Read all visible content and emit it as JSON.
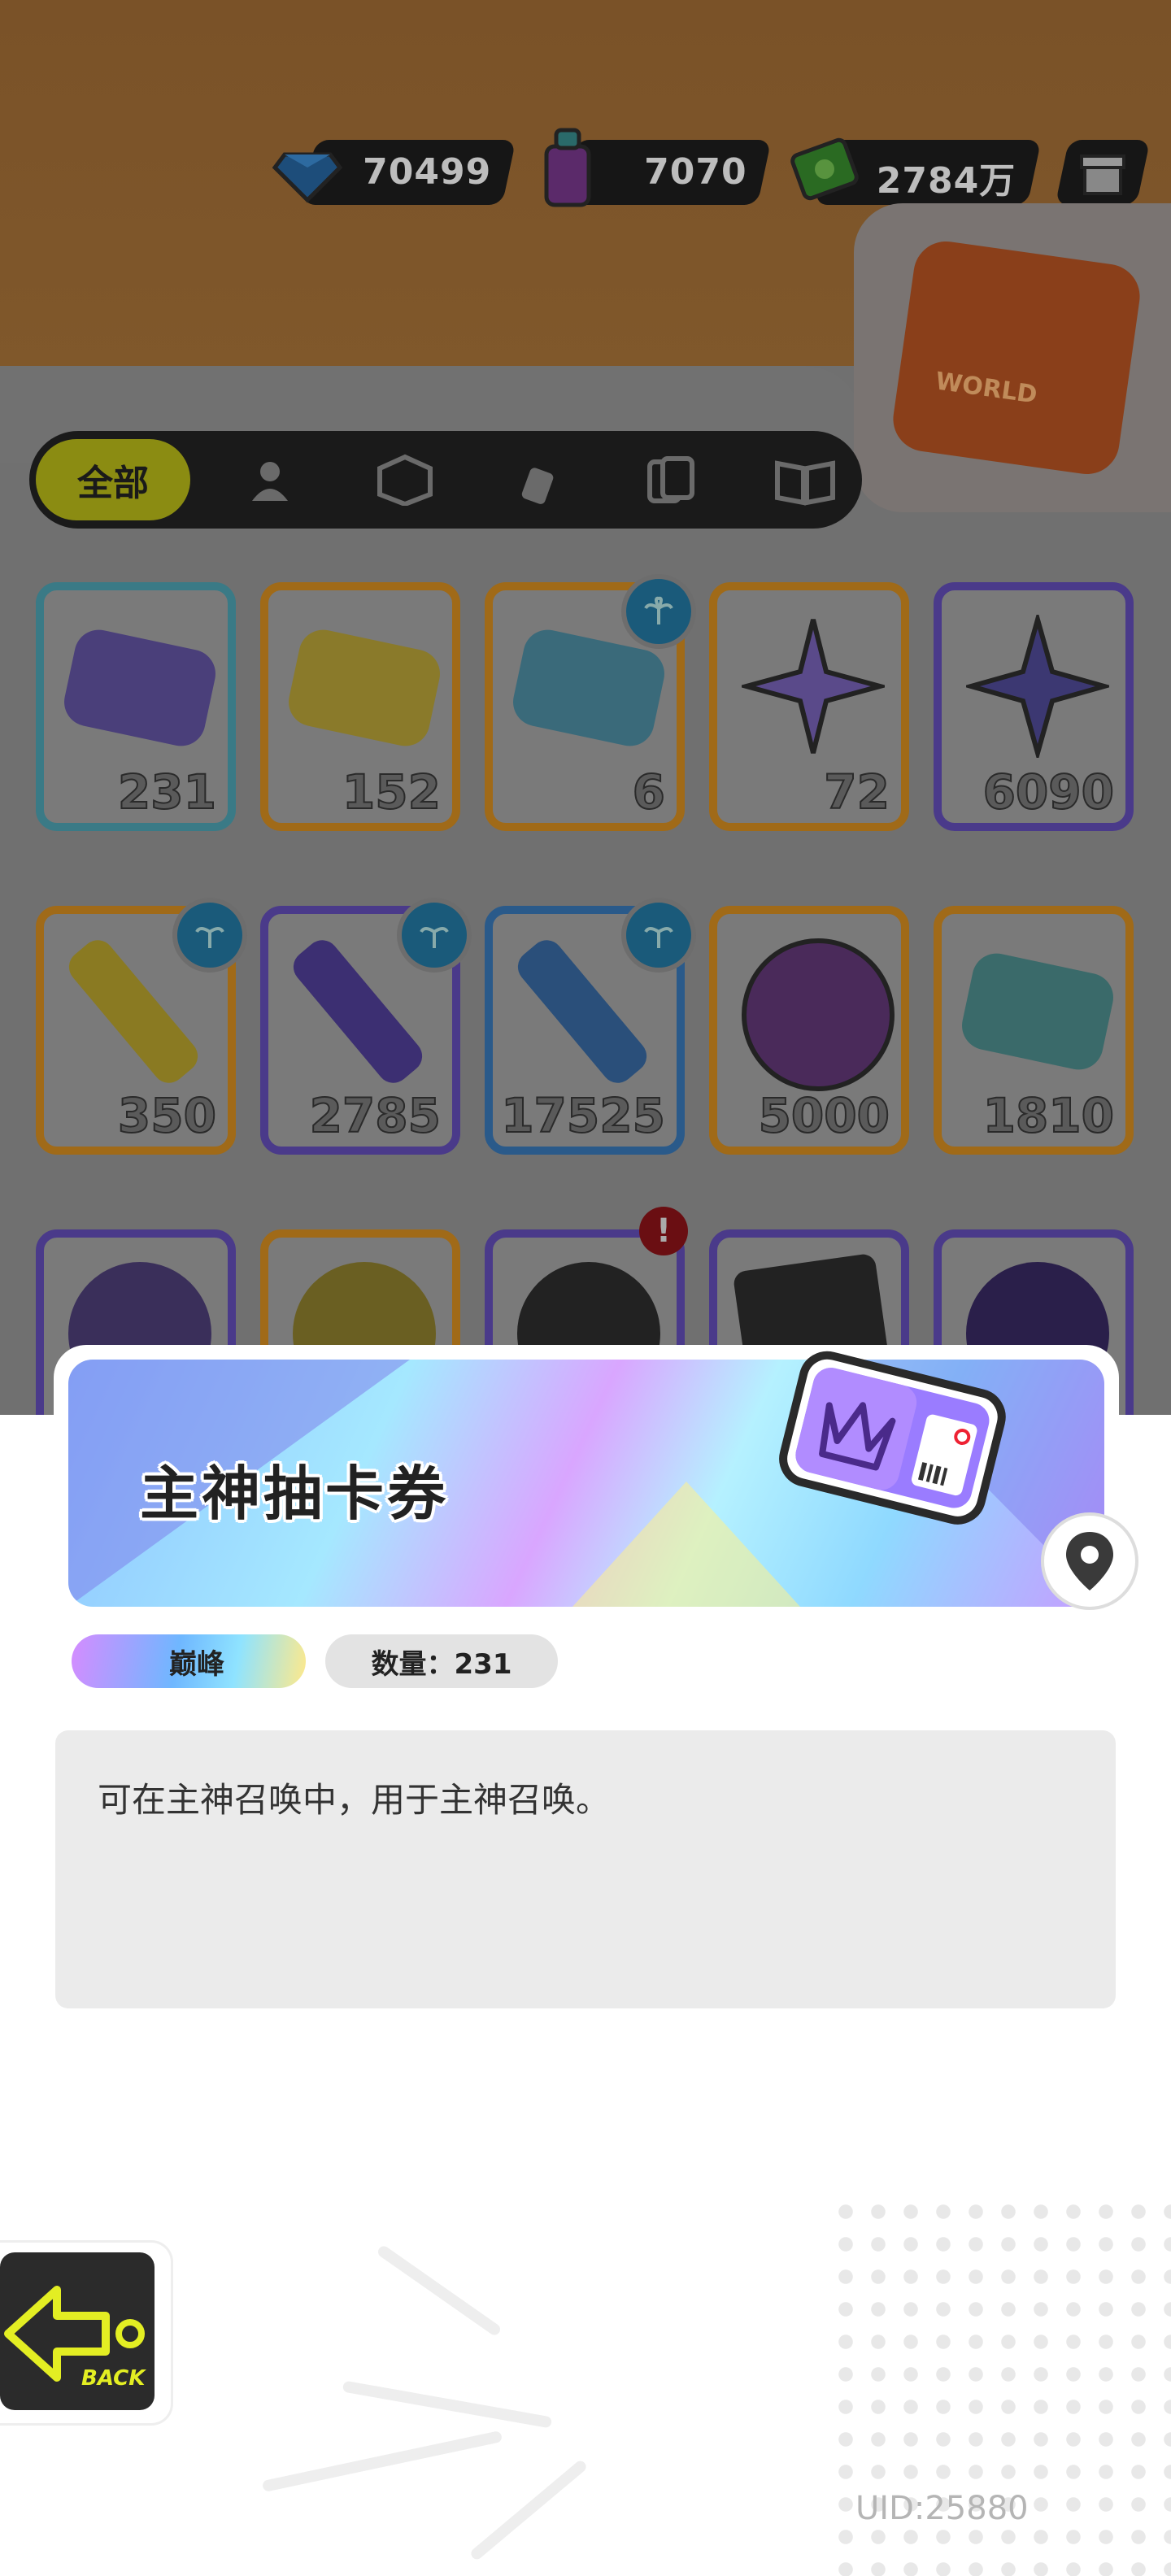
{
  "currencies": [
    {
      "name": "diamond",
      "amount": "70499",
      "icon": "diamond-icon"
    },
    {
      "name": "spray-can",
      "amount": "7070",
      "icon": "spray-can-icon"
    },
    {
      "name": "cash",
      "amount": "2784万",
      "icon": "cash-icon"
    }
  ],
  "gift_icon": "gift-box-icon",
  "event_badge": {
    "icon": "travel-suitcase-icon",
    "label": "WORLD"
  },
  "tabs": [
    {
      "label": "全部",
      "icon": "",
      "active": true
    },
    {
      "label": "",
      "icon": "person-icon",
      "active": false
    },
    {
      "label": "",
      "icon": "box-icon",
      "active": false
    },
    {
      "label": "",
      "icon": "spray-icon",
      "active": false
    },
    {
      "label": "",
      "icon": "cards-icon",
      "active": false
    },
    {
      "label": "",
      "icon": "book-icon",
      "active": false
    }
  ],
  "items": [
    {
      "count": "231",
      "icon": "purple-ticket-icon"
    },
    {
      "count": "152",
      "icon": "gold-ticket-icon"
    },
    {
      "count": "6",
      "icon": "wave-ticket-icon"
    },
    {
      "count": "72",
      "icon": "rainbow-star-icon"
    },
    {
      "count": "6090",
      "icon": "purple-star-icon"
    },
    {
      "count": "350",
      "icon": "yellow-crayon-icon"
    },
    {
      "count": "2785",
      "icon": "purple-crayon-icon"
    },
    {
      "count": "17525",
      "icon": "blue-crayon-icon"
    },
    {
      "count": "5000",
      "icon": "cool-sticker-icon"
    },
    {
      "count": "1810",
      "icon": "face-ticket-icon"
    }
  ],
  "detail": {
    "title": "主神抽卡券",
    "rarity": "巅峰",
    "quantity": "数量：231",
    "description": "可在主神召唤中，用于主神召唤。"
  },
  "back_label": "BACK",
  "uid": "UID:25880"
}
